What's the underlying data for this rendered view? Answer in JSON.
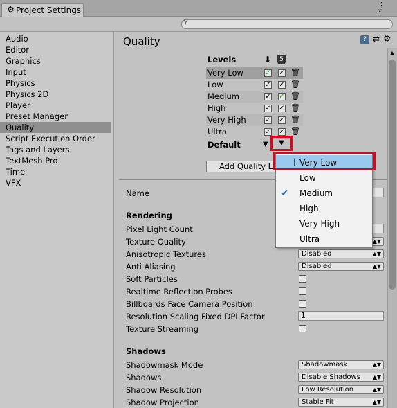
{
  "window": {
    "tab_title": "Project Settings",
    "menu_icon": "⋮",
    "close_icon": "x"
  },
  "search": {
    "placeholder": "",
    "icon": "search-icon"
  },
  "sidebar": {
    "items": [
      {
        "label": "Audio"
      },
      {
        "label": "Editor"
      },
      {
        "label": "Graphics"
      },
      {
        "label": "Input"
      },
      {
        "label": "Physics"
      },
      {
        "label": "Physics 2D"
      },
      {
        "label": "Player"
      },
      {
        "label": "Preset Manager"
      },
      {
        "label": "Quality",
        "selected": true
      },
      {
        "label": "Script Execution Order"
      },
      {
        "label": "Tags and Layers"
      },
      {
        "label": "TextMesh Pro"
      },
      {
        "label": "Time"
      },
      {
        "label": "VFX"
      }
    ]
  },
  "page": {
    "title": "Quality",
    "help_icon": "?"
  },
  "levels": {
    "header": "Levels",
    "platform_icons": [
      "download-icon",
      "html5-icon"
    ],
    "html5_glyph": "5",
    "rows": [
      {
        "name": "Very Low",
        "standalone": true,
        "webgl": true,
        "highlight": "standalone",
        "selected": true
      },
      {
        "name": "Low",
        "standalone": true,
        "webgl": true
      },
      {
        "name": "Medium",
        "standalone": true,
        "webgl": true,
        "highlight": "webgl"
      },
      {
        "name": "High",
        "standalone": true,
        "webgl": true
      },
      {
        "name": "Very High",
        "standalone": true,
        "webgl": true
      },
      {
        "name": "Ultra",
        "standalone": true,
        "webgl": true
      }
    ],
    "default_label": "Default",
    "add_button": "Add Quality Level"
  },
  "properties": {
    "name_label": "Name",
    "rendering": {
      "title": "Rendering",
      "pixel_light_count": "Pixel Light Count",
      "texture_quality": "Texture Quality",
      "anisotropic": {
        "label": "Anisotropic Textures",
        "value": "Disabled"
      },
      "anti_aliasing": {
        "label": "Anti Aliasing",
        "value": "Disabled"
      },
      "soft_particles": "Soft Particles",
      "realtime_reflection": "Realtime Reflection Probes",
      "billboards": "Billboards Face Camera Position",
      "resolution_scaling": {
        "label": "Resolution Scaling Fixed DPI Factor",
        "value": "1"
      },
      "texture_streaming": "Texture Streaming"
    },
    "shadows": {
      "title": "Shadows",
      "shadowmask_mode": {
        "label": "Shadowmask Mode",
        "value": "Shadowmask"
      },
      "shadows": {
        "label": "Shadows",
        "value": "Disable Shadows"
      },
      "shadow_resolution": {
        "label": "Shadow Resolution",
        "value": "Low Resolution"
      },
      "shadow_projection": {
        "label": "Shadow Projection",
        "value": "Stable Fit"
      }
    }
  },
  "popup": {
    "options": [
      "Very Low",
      "Low",
      "Medium",
      "High",
      "Very High",
      "Ultra"
    ],
    "hovered": "Very Low",
    "checked": "Medium",
    "check_glyph": "✔"
  },
  "colors": {
    "annotation_red": "#e3001b",
    "highlight_blue": "#99c9ef",
    "check_green": "#2a9d2a"
  }
}
